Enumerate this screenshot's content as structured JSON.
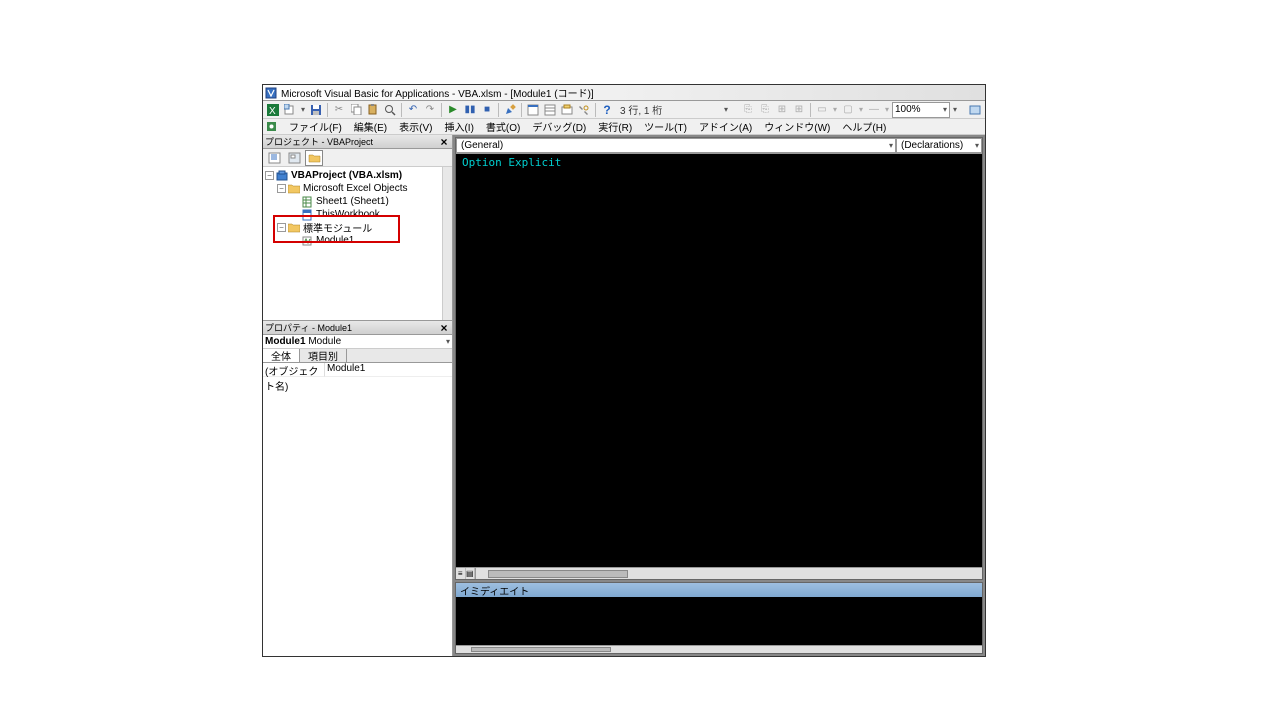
{
  "title": "Microsoft Visual Basic for Applications - VBA.xlsm - [Module1 (コード)]",
  "status_text": "3 行, 1 桁",
  "zoom": "100%",
  "menu": {
    "file": "ファイル(F)",
    "edit": "編集(E)",
    "view": "表示(V)",
    "insert": "挿入(I)",
    "format": "書式(O)",
    "debug": "デバッグ(D)",
    "run": "実行(R)",
    "tools": "ツール(T)",
    "addins": "アドイン(A)",
    "window": "ウィンドウ(W)",
    "help": "ヘルプ(H)"
  },
  "project_panel": {
    "title": "プロジェクト - VBAProject",
    "root": "VBAProject (VBA.xlsm)",
    "excel_objects": "Microsoft Excel Objects",
    "sheet1": "Sheet1 (Sheet1)",
    "thisworkbook": "ThisWorkbook",
    "std_modules": "標準モジュール",
    "module1": "Module1"
  },
  "properties_panel": {
    "title": "プロパティ - Module1",
    "combo_name": "Module1",
    "combo_type": "Module",
    "tab_all": "全体",
    "tab_cat": "項目別",
    "prop_key": "(オブジェクト名)",
    "prop_val": "Module1"
  },
  "code": {
    "combo_general": "(General)",
    "combo_decl": "(Declarations)",
    "line1": "Option Explicit"
  },
  "immediate": {
    "title": "イミディエイト"
  }
}
